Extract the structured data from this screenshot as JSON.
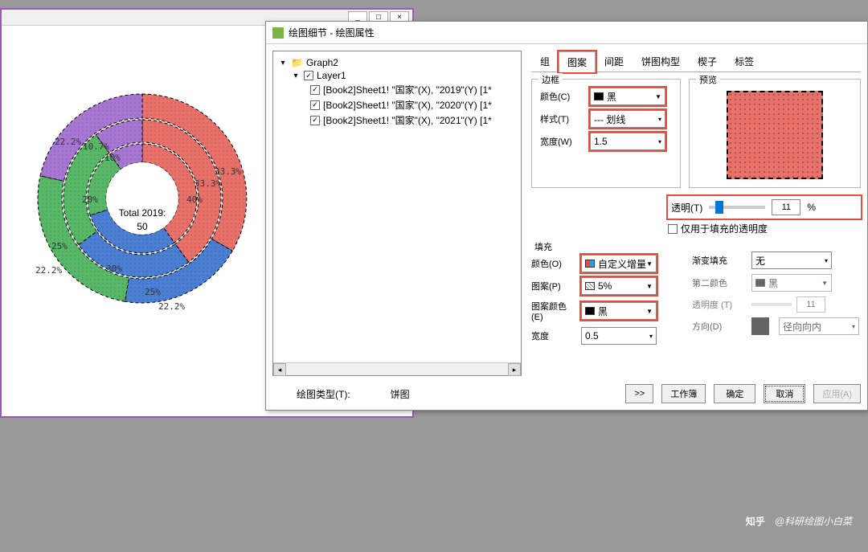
{
  "chart_window": {
    "center_text_line1": "Total 2019:",
    "center_text_line2": "50"
  },
  "chart_data": [
    {
      "type": "pie",
      "ring": "outer",
      "title": "2019",
      "series": [
        {
          "name": "red",
          "value": 33.3,
          "color": "#e8716a"
        },
        {
          "name": "blue",
          "value": 22.2,
          "color": "#4a7fd4"
        },
        {
          "name": "green",
          "value": 22.2,
          "color": "#58b868"
        },
        {
          "name": "purple",
          "value": 22.2,
          "color": "#a877d4"
        }
      ]
    },
    {
      "type": "pie",
      "ring": "middle",
      "title": "2020",
      "series": [
        {
          "name": "red",
          "value": 40,
          "color": "#e8716a"
        },
        {
          "name": "blue",
          "value": 25,
          "color": "#4a7fd4"
        },
        {
          "name": "green",
          "value": 25,
          "color": "#58b868"
        },
        {
          "name": "purple",
          "value": 10.7,
          "color": "#a877d4"
        }
      ]
    },
    {
      "type": "pie",
      "ring": "inner",
      "title": "2021",
      "series": [
        {
          "name": "red",
          "value": 40,
          "color": "#e8716a"
        },
        {
          "name": "blue",
          "value": 30,
          "color": "#4a7fd4"
        },
        {
          "name": "green",
          "value": 20,
          "color": "#58b868"
        },
        {
          "name": "purple",
          "value": 10,
          "color": "#a877d4"
        }
      ]
    }
  ],
  "dialog": {
    "title": "绘图细节 - 绘图属性",
    "tree": {
      "root": "Graph2",
      "layer": "Layer1",
      "items": [
        "[Book2]Sheet1! \"国家\"(X), \"2019\"(Y) [1*",
        "[Book2]Sheet1! \"国家\"(X), \"2020\"(Y) [1*",
        "[Book2]Sheet1! \"国家\"(X), \"2021\"(Y) [1*"
      ]
    },
    "plot_type_label": "绘图类型(T):",
    "plot_type_value": "饼图",
    "tabs": [
      "组",
      "图案",
      "间距",
      "饼图构型",
      "楔子",
      "标签"
    ],
    "active_tab": "图案",
    "border": {
      "legend": "边框",
      "color_label": "颜色(C)",
      "color_value": "黑",
      "style_label": "样式(T)",
      "style_value": "--- 划线",
      "width_label": "宽度(W)",
      "width_value": "1.5"
    },
    "preview": {
      "legend": "预览"
    },
    "transparency": {
      "label": "透明(T)",
      "value": "11",
      "percent": "%",
      "fill_only_label": "仅用于填充的透明度"
    },
    "fill": {
      "legend": "填充",
      "color_label": "颜色(O)",
      "color_value": "自定义增量",
      "pattern_label": "图案(P)",
      "pattern_value": "5%",
      "pattern_color_label": "图案颜色(E)",
      "pattern_color_value": "黑",
      "width_label": "宽度",
      "width_value": "0.5"
    },
    "gradient": {
      "mode_label": "渐变填充",
      "mode_value": "无",
      "second_color_label": "第二颜色",
      "second_color_value": "黑",
      "transparency_label": "透明度 (T)",
      "transparency_value": "11",
      "direction_label": "方向(D)",
      "direction_value": "径向向内"
    },
    "buttons": {
      "arrow": ">>",
      "workbook": "工作簿",
      "ok": "确定",
      "cancel": "取消",
      "apply": "应用(A)"
    }
  },
  "watermark": {
    "logo": "知乎",
    "text": "@科研绘图小白菜"
  }
}
